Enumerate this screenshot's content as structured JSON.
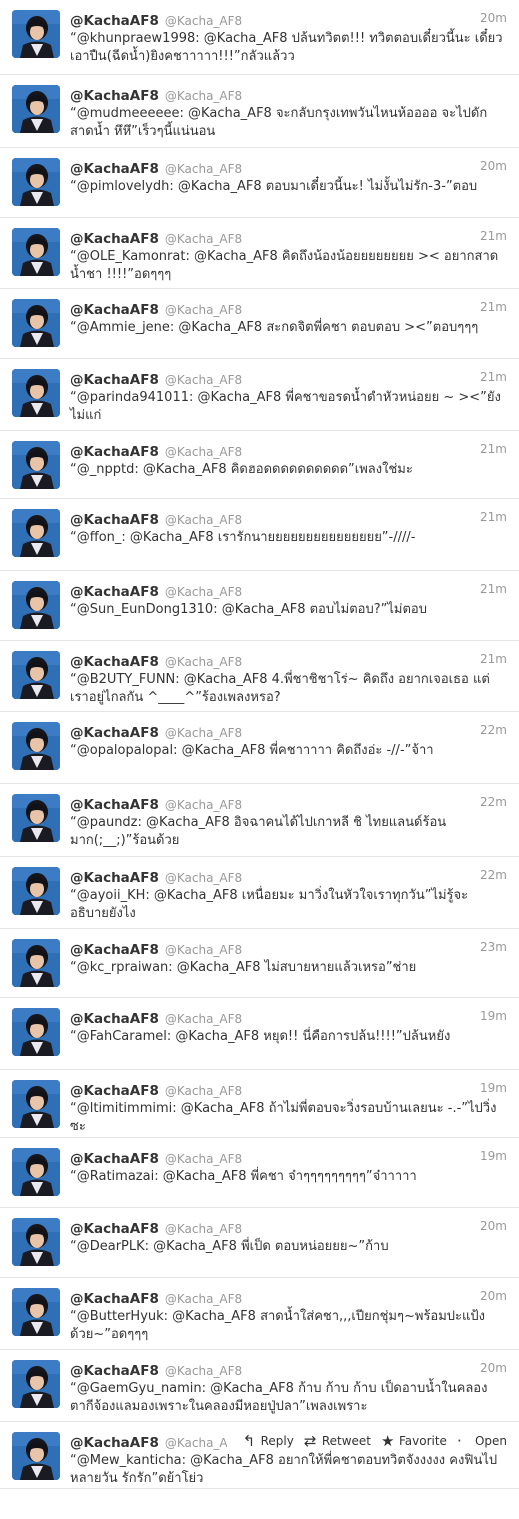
{
  "timeline": {
    "tweets": [
      {
        "name": "@KachaAF8",
        "handle": "@Kacha_AF8",
        "time": "20m",
        "text": "“@khunpraew1998: @Kacha_AF8 ปล้นทวิตต!!! ทวิตตอบเดี๋ยวนี้นะ เดี๋ยวเอาปืน(ฉีดน้ำ)ยิงคชาาาาา!!!”กลัวแล้วว"
      },
      {
        "name": "@KachaAF8",
        "handle": "@Kacha_AF8",
        "time": "",
        "text": "“@mudmeeeeee: @Kacha_AF8 จะกลับกรุงเทพวันไหนห้ออออ จะไปดักสาดน้ำ หึหึ”เร็วๆนี้แน่นอน"
      },
      {
        "name": "@KachaAF8",
        "handle": "@Kacha_AF8",
        "time": "20m",
        "text": "“@pimlovelydh: @Kacha_AF8 ตอบมาเดี๋ยวนี้นะ! ไม่งั้นไม่รัก-3-”ตอบ"
      },
      {
        "name": "@KachaAF8",
        "handle": "@Kacha_AF8",
        "time": "21m",
        "text": "“@OLE_Kamonrat: @Kacha_AF8 คิดถึงน้องน้อยยยยยยยย >< อยากสาดน้ำชา !!!!”อดๆๆๆ"
      },
      {
        "name": "@KachaAF8",
        "handle": "@Kacha_AF8",
        "time": "21m",
        "text": "“@Ammie_jene: @Kacha_AF8 สะกดจิตพี่คชา ตอบตอบ ><”ตอบๆๆๆ"
      },
      {
        "name": "@KachaAF8",
        "handle": "@Kacha_AF8",
        "time": "21m",
        "text": "“@parinda941011: @Kacha_AF8 พี่คชาขอรดน้ำดำหัวหน่อยย ~ ><”ยังไม่แก่"
      },
      {
        "name": "@KachaAF8",
        "handle": "@Kacha_AF8",
        "time": "21m",
        "text": "“@_npptd: @Kacha_AF8 คิดฮอดดดดดดดดดด”เพลงใช่มะ"
      },
      {
        "name": "@KachaAF8",
        "handle": "@Kacha_AF8",
        "time": "21m",
        "text": "“@ffon_: @Kacha_AF8 เรารักนายยยยยยยยยยยยยยย”-////-"
      },
      {
        "name": "@KachaAF8",
        "handle": "@Kacha_AF8",
        "time": "21m",
        "text": "“@Sun_EunDong1310: @Kacha_AF8 ตอบไม่ตอบ?”ไม่ตอบ"
      },
      {
        "name": "@KachaAF8",
        "handle": "@Kacha_AF8",
        "time": "21m",
        "text": "“@B2UTY_FUNN: @Kacha_AF8 4.พี่ชาชิชาโร่~ คิดถึง อยากเจอเธอ แต่เราอยู่ไกลกัน ^____^”ร้องเพลงหรอ?"
      },
      {
        "name": "@KachaAF8",
        "handle": "@Kacha_AF8",
        "time": "22m",
        "text": "“@opalopalopal: @Kacha_AF8 พี่คชาาาาา คิดถึงอ่ะ -//-”จ้าา"
      },
      {
        "name": "@KachaAF8",
        "handle": "@Kacha_AF8",
        "time": "22m",
        "text": "“@paundz: @Kacha_AF8 อิจฉาคนได้ไปเกาหลี ชิ ไทยแลนด์ร้อนมาก(;__;)”ร้อนด้วย"
      },
      {
        "name": "@KachaAF8",
        "handle": "@Kacha_AF8",
        "time": "22m",
        "text": "“@ayoii_KH: @Kacha_AF8 เหนื่อยมะ มาวิ่งในหัวใจเราทุกวัน”ไม่รู้จะอธิบายยังไง"
      },
      {
        "name": "@KachaAF8",
        "handle": "@Kacha_AF8",
        "time": "23m",
        "text": "“@kc_rpraiwan: @Kacha_AF8 ไม่สบายหายแล้วเหรอ”ช่าย"
      },
      {
        "name": "@KachaAF8",
        "handle": "@Kacha_AF8",
        "time": "19m",
        "text": "“@FahCaramel: @Kacha_AF8 หยุด!! นี่คือการปล้น!!!!”ปล้นหยัง"
      },
      {
        "name": "@KachaAF8",
        "handle": "@Kacha_AF8",
        "time": "19m",
        "text": "“@ltimitimmimi: @Kacha_AF8 ถ้าไม่พี่ตอบจะวิ่งรอบบ้านเลยนะ -.-”ไปวิ่งซะ"
      },
      {
        "name": "@KachaAF8",
        "handle": "@Kacha_AF8",
        "time": "19m",
        "text": "“@Ratimazai: @Kacha_AF8 พี่คชา จ๋าๆๆๆๆๆๆๆๆๆ”จ๋าาาาา"
      },
      {
        "name": "@KachaAF8",
        "handle": "@Kacha_AF8",
        "time": "20m",
        "text": "“@DearPLK: @Kacha_AF8 พี่เป็ด ตอบหน่อยยย~”ก้าบ"
      },
      {
        "name": "@KachaAF8",
        "handle": "@Kacha_AF8",
        "time": "20m",
        "text": "“@ButterHyuk: @Kacha_AF8 สาดน้ำใส่คชา,,,เปียกชุ่มๆ~พร้อมปะแป้งด้วย~”อดๆๆๆ"
      },
      {
        "name": "@KachaAF8",
        "handle": "@Kacha_AF8",
        "time": "20m",
        "text": "“@GaemGyu_namin: @Kacha_AF8 ก้าบ ก้าบ ก้าบ เป็ดอาบน้ำในคลองตากีจ้องแลมองเพราะในคลองมีหอยปู่ปลา”เพลงเพราะ"
      },
      {
        "name": "@KachaAF8",
        "handle": "@Kacha_AF8",
        "time": "",
        "text": "“@Mew_kanticha: @Kacha_AF8 อยากให้พี่คชาตอบทวิตจังงงงง คงฟินไปหลายวัน รักรัก”ดย้าโย่ว"
      }
    ],
    "hover_actions": {
      "reply": "Reply",
      "retweet": "Retweet",
      "favorite": "Favorite",
      "open": "Open"
    }
  },
  "icons": {
    "reply": "reply-arrow-icon",
    "retweet": "retweet-icon",
    "favorite": "star-icon"
  },
  "colors": {
    "name": "#333333",
    "muted": "#999999",
    "avatar_bg": "#2f6fb6"
  }
}
